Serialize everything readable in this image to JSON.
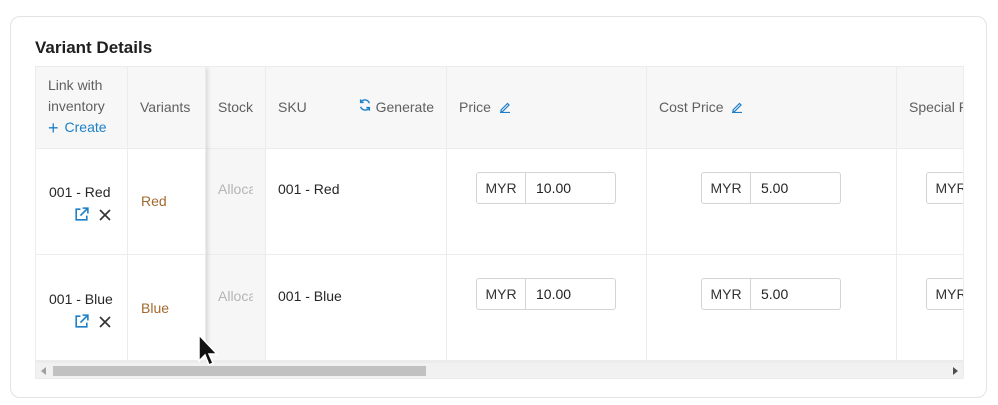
{
  "section": {
    "title": "Variant Details"
  },
  "columns": {
    "link_line1": "Link with",
    "link_line2": "inventory",
    "create_label": "Create",
    "variants": "Variants",
    "stock": "Stock",
    "sku": "SKU",
    "generate_label": "Generate",
    "price": "Price",
    "cost_price": "Cost Price",
    "special_price": "Special Price"
  },
  "rows": [
    {
      "inventory": "001 - Red",
      "variant": "Red",
      "stock": "Allocate",
      "sku": "001 - Red",
      "price_currency": "MYR",
      "price": "10.00",
      "cost_currency": "MYR",
      "cost": "5.00",
      "special_currency": "MYR"
    },
    {
      "inventory": "001 - Blue",
      "variant": "Blue",
      "stock": "Allocate",
      "sku": "001 - Blue",
      "price_currency": "MYR",
      "price": "10.00",
      "cost_currency": "MYR",
      "cost": "5.00",
      "special_currency": "MYR"
    }
  ],
  "icons": {
    "create": "plus-icon",
    "generate": "refresh-icon",
    "edit": "pencil-icon",
    "open": "external-link-icon",
    "remove": "close-icon"
  },
  "colors": {
    "accent": "#1d7fc7",
    "variant_text": "#a36a2e"
  }
}
